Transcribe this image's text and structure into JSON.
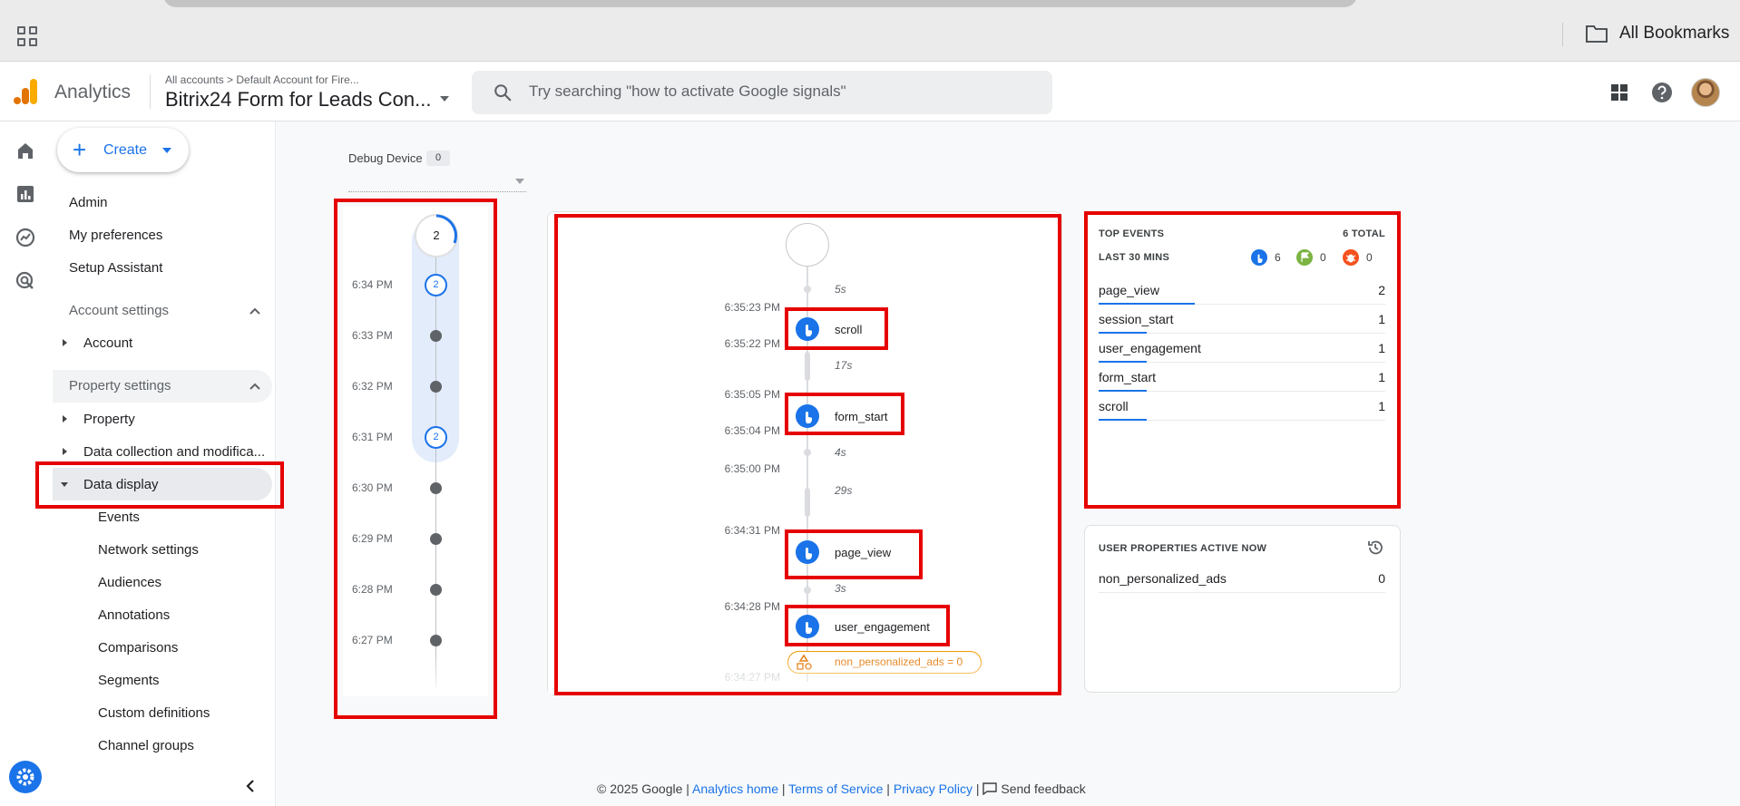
{
  "browser": {
    "bookmarks_label": "All Bookmarks"
  },
  "header": {
    "app_name": "Analytics",
    "breadcrumb": "All accounts > Default Account for Fire...",
    "property_title": "Bitrix24 Form for Leads Con...",
    "search_placeholder": "Try searching \"how to activate Google signals\""
  },
  "nav": {
    "create_label": "Create",
    "top_items": [
      "Admin",
      "My preferences",
      "Setup Assistant"
    ],
    "account_settings": "Account settings",
    "account": "Account",
    "property_settings": "Property settings",
    "property": "Property",
    "data_collection": "Data collection and modifica...",
    "data_display": "Data display",
    "sub_items": [
      "Events",
      "Network settings",
      "Audiences",
      "Annotations",
      "Comparisons",
      "Segments",
      "Custom definitions",
      "Channel groups"
    ]
  },
  "debug": {
    "device_label": "Debug Device",
    "device_count": "0",
    "minutes": {
      "top_count": "2",
      "rows": [
        {
          "time": "6:34 PM",
          "count": "2"
        },
        {
          "time": "6:33 PM",
          "count": ""
        },
        {
          "time": "6:32 PM",
          "count": ""
        },
        {
          "time": "6:31 PM",
          "count": "2"
        },
        {
          "time": "6:30 PM",
          "count": ""
        },
        {
          "time": "6:29 PM",
          "count": ""
        },
        {
          "time": "6:28 PM",
          "count": ""
        },
        {
          "time": "6:27 PM",
          "count": ""
        }
      ]
    },
    "seconds": {
      "times": [
        "6:35:23 PM",
        "6:35:22 PM",
        "6:35:05 PM",
        "6:35:04 PM",
        "6:35:00 PM",
        "6:34:31 PM",
        "6:34:28 PM",
        "6:34:27 PM"
      ],
      "gaps": [
        "5s",
        "17s",
        "4s",
        "29s",
        "3s"
      ],
      "events": [
        "scroll",
        "form_start",
        "page_view",
        "user_engagement"
      ],
      "user_property_change": "non_personalized_ads = 0"
    }
  },
  "top_events": {
    "title": "TOP EVENTS",
    "total": "6 TOTAL",
    "period": "LAST 30 MINS",
    "counts": {
      "events": "6",
      "conversions": "0",
      "errors": "0"
    },
    "rows": [
      {
        "name": "page_view",
        "value": "2"
      },
      {
        "name": "session_start",
        "value": "1"
      },
      {
        "name": "user_engagement",
        "value": "1"
      },
      {
        "name": "form_start",
        "value": "1"
      },
      {
        "name": "scroll",
        "value": "1"
      }
    ]
  },
  "user_properties": {
    "title": "USER PROPERTIES ACTIVE NOW",
    "rows": [
      {
        "name": "non_personalized_ads",
        "value": "0"
      }
    ]
  },
  "footer": {
    "copyright": "© 2025 Google",
    "links": [
      "Analytics home",
      "Terms of Service",
      "Privacy Policy"
    ],
    "feedback": "Send feedback"
  },
  "colors": {
    "accent": "#1a73e8",
    "annotation": "#e60000",
    "user_prop": "#e37400"
  }
}
